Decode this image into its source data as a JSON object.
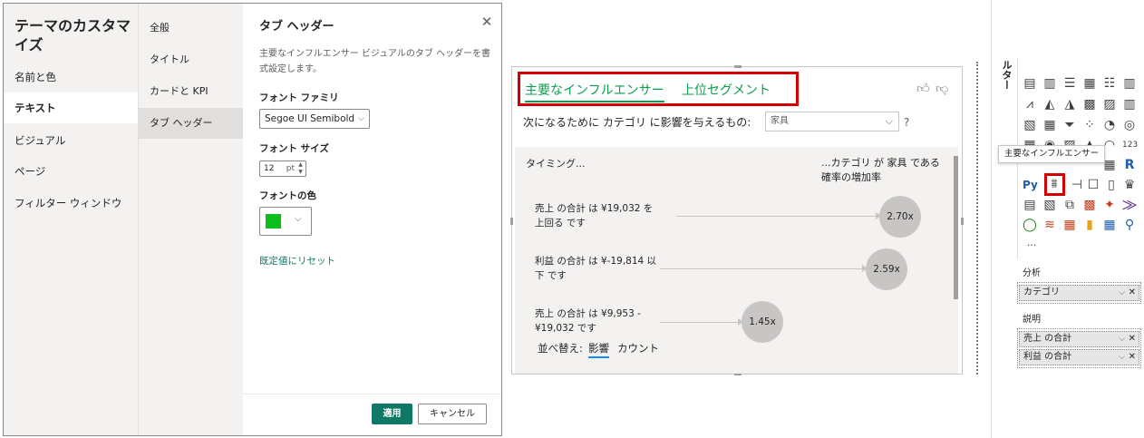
{
  "dialog": {
    "title": "テーマのカスタマイズ",
    "nav1": [
      "名前と色",
      "テキスト",
      "ビジュアル",
      "ページ",
      "フィルター ウィンドウ"
    ],
    "nav2": [
      "全般",
      "タイトル",
      "カードと KPI",
      "タブ ヘッダー"
    ],
    "panel_title": "タブ ヘッダー",
    "close": "✕",
    "description": "主要なインフルエンサー ビジュアルのタブ ヘッダーを書式設定します。",
    "font_family_label": "フォント ファミリ",
    "font_family_value": "Segoe UI Semibold",
    "font_size_label": "フォント サイズ",
    "font_size_value": "12",
    "font_size_unit": "pt",
    "font_color_label": "フォントの色",
    "font_color_value": "#0bbf1a",
    "reset_label": "既定値にリセット",
    "apply_label": "適用",
    "cancel_label": "キャンセル"
  },
  "visual": {
    "tab_influencers": "主要なインフルエンサー",
    "tab_segments": "上位セグメント",
    "question": "次になるために カテゴリ に影響を与えるもの:",
    "question_value": "家具",
    "question_mark": "?",
    "header_left": "タイミング...",
    "header_right_1": "...カテゴリ が 家具 である",
    "header_right_2": "確率の増加率",
    "rows": [
      {
        "line1": "売上 の合計 は ¥19,032 を",
        "line2": "上回る です",
        "value": "2.70x"
      },
      {
        "line1": "利益 の合計 は ¥-19,814 以",
        "line2": "下 です",
        "value": "2.59x"
      },
      {
        "line1": "売上 の合計 は ¥9,953 -",
        "line2": "¥19,032 です",
        "value": "1.45x"
      }
    ],
    "sort_label": "並べ替え:",
    "sort_influence": "影響",
    "sort_count": "カウント",
    "tab_color": "#0f9d4f"
  },
  "vizpane": {
    "side_tab": "ルター",
    "tooltip": "主要なインフルエンサー",
    "more": "...",
    "analyze_label": "分析",
    "analyze_field": "カテゴリ",
    "explain_label": "説明",
    "explain_fields": [
      "売上 の合計",
      "利益 の合計"
    ]
  }
}
